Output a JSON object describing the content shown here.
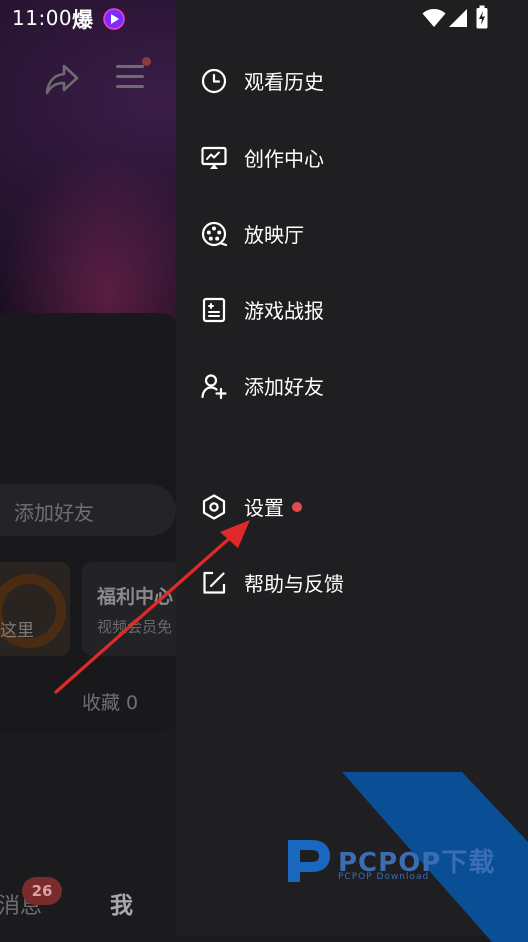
{
  "status_bar": {
    "time": "11:00",
    "icons": [
      "explosion-icon",
      "video-app-icon",
      "wifi-icon",
      "signal-icon",
      "battery-charging-icon"
    ],
    "explosion_glyph": "爆"
  },
  "background": {
    "header_icons": [
      "share-icon",
      "menu-icon"
    ],
    "add_friend_label": "添加好友",
    "tile_left_caption": "这里",
    "tile_right": {
      "title": "福利中心",
      "subtitle": "视频会员免"
    },
    "favorites": "收藏 0",
    "tabbar": {
      "messages_label": "消息",
      "messages_badge": "26",
      "me_label": "我"
    }
  },
  "drawer": {
    "items": [
      {
        "label": "观看历史",
        "icon": "clock-icon"
      },
      {
        "label": "创作中心",
        "icon": "creator-screen-icon"
      },
      {
        "label": "放映厅",
        "icon": "film-reel-icon"
      },
      {
        "label": "游戏战报",
        "icon": "game-report-icon"
      },
      {
        "label": "添加好友",
        "icon": "add-user-icon"
      },
      {
        "label": "设置",
        "icon": "settings-hexagon-icon",
        "badge_dot": true
      },
      {
        "label": "帮助与反馈",
        "icon": "edit-feedback-icon"
      }
    ]
  },
  "watermark": {
    "text": "PCPOP下载",
    "sub": "PCPOP Download"
  },
  "colors": {
    "drawer_bg": "#1f1f22",
    "dot": "#e24b4b",
    "arrow": "#e02a2a",
    "watermark": "#0a4f96"
  }
}
